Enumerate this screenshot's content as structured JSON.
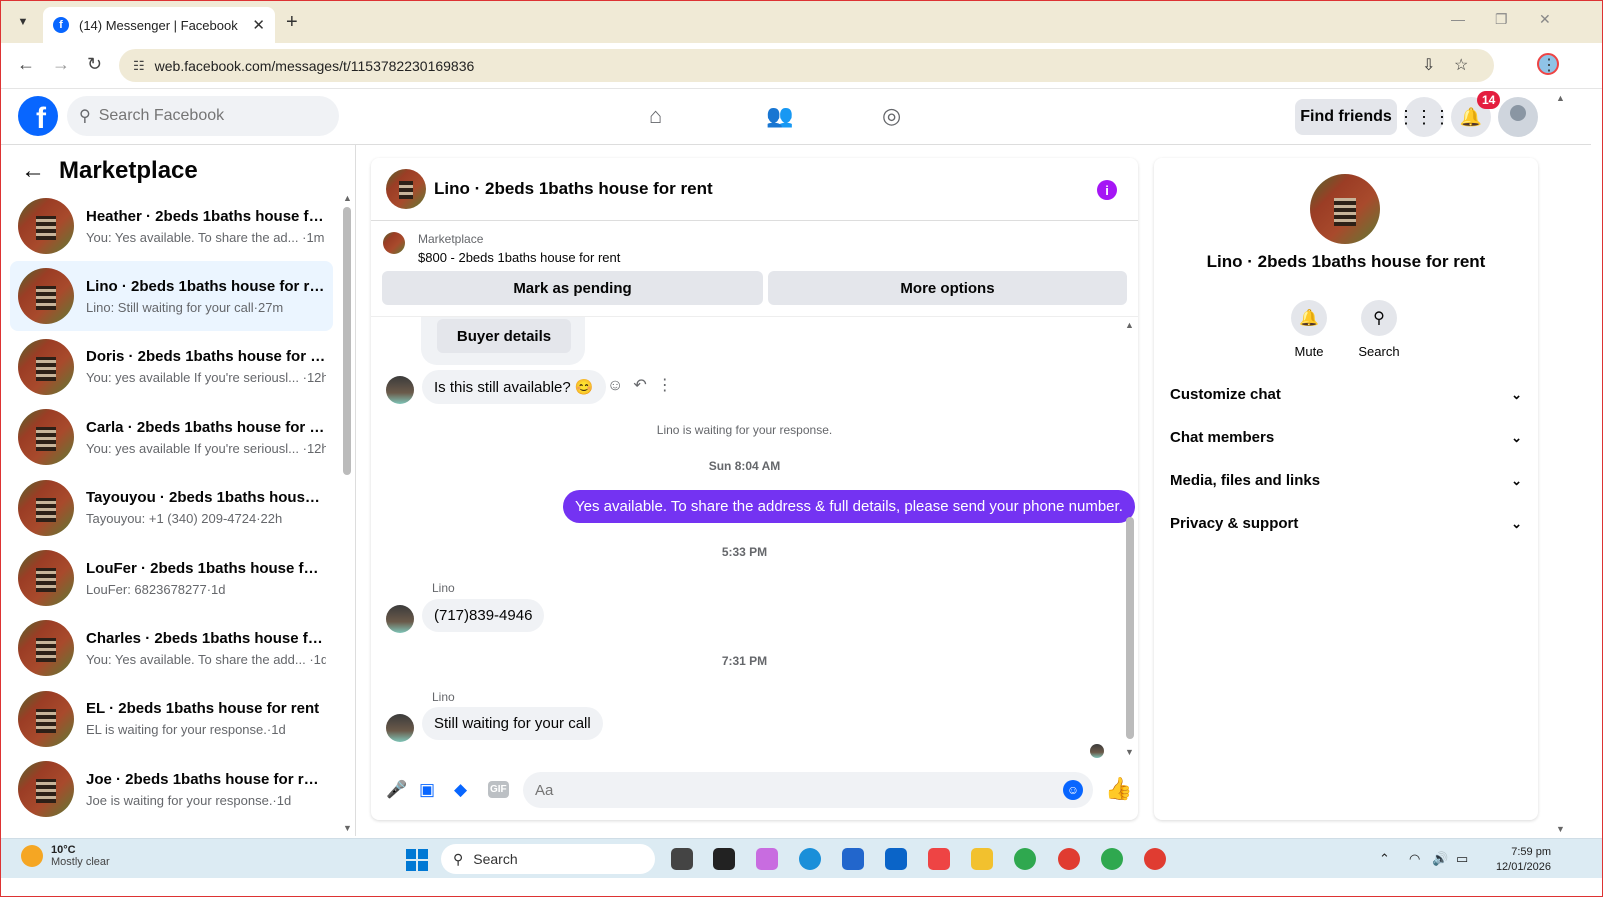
{
  "browser": {
    "tab_title": "(14) Messenger | Facebook",
    "url": "web.facebook.com/messages/t/1153782230169836"
  },
  "header": {
    "search_placeholder": "Search Facebook",
    "find_friends": "Find friends",
    "notification_count": "14"
  },
  "sidebar": {
    "title": "Marketplace",
    "conversations": [
      {
        "name": "Heather · 2beds 1baths house fo...",
        "preview": "You: Yes available. To share the ad... ·1m",
        "active": false
      },
      {
        "name": "Lino · 2beds 1baths house for rent",
        "preview": "Lino: Still waiting for your call·27m",
        "active": true
      },
      {
        "name": "Doris · 2beds 1baths house for r...",
        "preview": "You: yes available If you're seriousl... ·12h",
        "active": false
      },
      {
        "name": "Carla · 2beds 1baths house for r...",
        "preview": "You: yes available If you're seriousl... ·12h",
        "active": false
      },
      {
        "name": "Tayouyou · 2beds 1baths house f...",
        "preview": "Tayouyou: +1 (340) 209-4724·22h",
        "active": false
      },
      {
        "name": "LouFer · 2beds 1baths house for ...",
        "preview": "LouFer: 6823678277·1d",
        "active": false
      },
      {
        "name": "Charles · 2beds 1baths house for...",
        "preview": "You: Yes available. To share the add... ·1d",
        "active": false
      },
      {
        "name": "EL · 2beds 1baths house for rent",
        "preview": "EL is waiting for your response.·1d",
        "active": false
      },
      {
        "name": "Joe · 2beds 1baths house for rent",
        "preview": "Joe is waiting for your response.·1d",
        "active": false
      }
    ]
  },
  "chat": {
    "title": "Lino · 2beds 1baths house for rent",
    "marketplace_label": "Marketplace",
    "listing": "$800 - 2beds 1baths house for rent",
    "mark_pending": "Mark as pending",
    "more_options": "More options",
    "buyer_details": "Buyer details",
    "msg1": "Is this still available? 😊",
    "waiting_note": "Lino is waiting for your response.",
    "stamp1": "Sun 8:04 AM",
    "my_msg": "Yes available. To share the address & full details, please send your phone number.",
    "stamp2": "5:33 PM",
    "sender": "Lino",
    "msg2": "(717)839-4946",
    "stamp3": "7:31 PM",
    "msg3": "Still waiting for your call",
    "composer_placeholder": "Aa"
  },
  "info": {
    "name": "Lino · 2beds 1baths house for rent",
    "mute": "Mute",
    "search": "Search",
    "sections": [
      "Customize chat",
      "Chat members",
      "Media, files and links",
      "Privacy & support"
    ]
  },
  "taskbar": {
    "temp": "10°C",
    "condition": "Mostly clear",
    "search": "Search",
    "time": "7:59 pm",
    "date": "12/01/2026"
  },
  "colors": {
    "accent": "#0866ff",
    "my_bubble": "#7433f2",
    "info_icon": "#a516f5"
  }
}
